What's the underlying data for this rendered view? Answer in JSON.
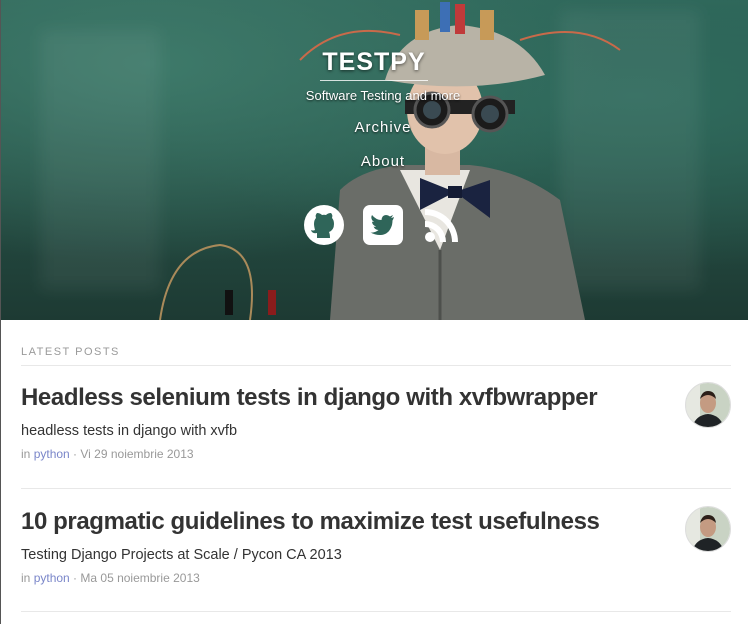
{
  "site": {
    "title": "TESTPY",
    "tagline": "Software Testing and more"
  },
  "nav": {
    "items": [
      {
        "label": "Archive"
      },
      {
        "label": "About"
      }
    ]
  },
  "social": {
    "icons": [
      "github-icon",
      "twitter-icon",
      "rss-icon"
    ]
  },
  "section": {
    "label": "LATEST POSTS"
  },
  "posts": [
    {
      "title": "Headless selenium tests in django with xvfbwrapper",
      "subtitle": "headless tests in django with xvfb",
      "meta_prefix": "in ",
      "category": "python",
      "separator": " · ",
      "date": "Vi 29 noiembrie 2013"
    },
    {
      "title": "10 pragmatic guidelines to maximize test usefulness",
      "subtitle": "Testing Django Projects at Scale / Pycon CA 2013",
      "meta_prefix": "in ",
      "category": "python",
      "separator": " · ",
      "date": "Ma 05 noiembrie 2013"
    }
  ],
  "colors": {
    "accent_link": "#7a86c9",
    "hero_base": "#2f6559"
  }
}
